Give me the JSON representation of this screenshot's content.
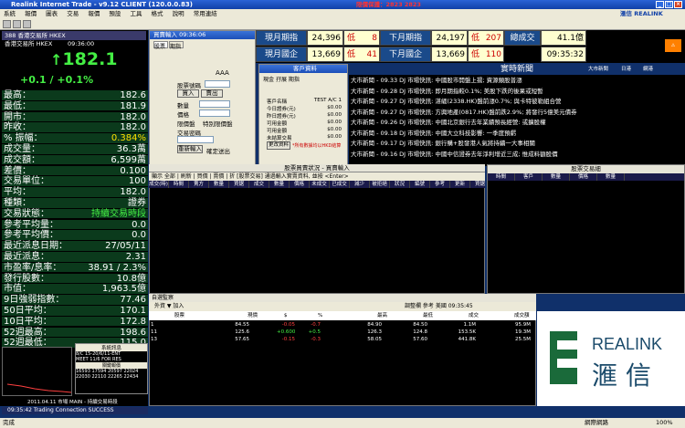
{
  "window": {
    "title": "Realink Internet Trade - v9.12 CLIENT (120.0.0.83)",
    "warning": "限價保護：2823 2823",
    "brand": "滙信 REALINK"
  },
  "menu": [
    "系統",
    "報價",
    "圖表",
    "交易",
    "報價",
    "預設",
    "工具",
    "格式",
    "說明",
    "常用連結"
  ],
  "left": {
    "header": "388 香港交易所 HKEX",
    "subheader": "香港交易所 HKEX",
    "time": "09:36:00",
    "price": "182.1",
    "arrow": "↑",
    "change": "+0.1 / +0.1%",
    "rows": [
      {
        "k": "最高：",
        "v": "182.6"
      },
      {
        "k": "最低：",
        "v": "181.9"
      },
      {
        "k": "開市：",
        "v": "182.0"
      },
      {
        "k": "昨收：",
        "v": "182.0"
      },
      {
        "k": "% 振幅：",
        "v": "0.384%"
      },
      {
        "k": "成交量：",
        "v": "36.3萬"
      },
      {
        "k": "成交額：",
        "v": "6,599萬"
      },
      {
        "k": "差價：",
        "v": "0.100"
      },
      {
        "k": "交易單位：",
        "v": "100"
      },
      {
        "k": "平均：",
        "v": "182.0"
      },
      {
        "k": "種類：",
        "v": "證券"
      },
      {
        "k": "交易狀態：",
        "v": "持續交易時段"
      },
      {
        "k": "參考平均量：",
        "v": "0.0"
      },
      {
        "k": "參考平均價：",
        "v": "0.0"
      },
      {
        "k": "最近派息日期：",
        "v": "27/05/11"
      },
      {
        "k": "最近派息：",
        "v": "2.31"
      },
      {
        "k": "市盈率/息率：",
        "v": "38.91 / 2.3%"
      },
      {
        "k": "發行股數：",
        "v": "10.8億"
      },
      {
        "k": "市值：",
        "v": "1,963.5億"
      },
      {
        "k": "9日強弱指數：",
        "v": "77.46"
      },
      {
        "k": "50日平均：",
        "v": "170.1"
      },
      {
        "k": "10日平均：",
        "v": "172.8"
      },
      {
        "k": "52週最高：",
        "v": "198.6"
      },
      {
        "k": "52週最低：",
        "v": "115.0"
      }
    ],
    "newsbox_title": "系統訊息",
    "newsbox_lines": [
      "8/C 15-20/6/11-ENT",
      "MEET 11/6 FOR RES",
      "關鍵報價",
      "16593 17594 20597 22024",
      "22030 22110 22265 22434"
    ],
    "date_line": "2011.04.11  市場 MAIN - 持續交易時段",
    "status": "09:35:42   Trading Connection SUCCESS"
  },
  "order": {
    "title": "買賣輸入 09:36:06",
    "tabs": [
      "股票",
      "期指"
    ],
    "labels": {
      "code": "股票號碼",
      "buy": "買入",
      "sell": "賣出",
      "qty": "數量",
      "price": "價格",
      "cond": "限價盤",
      "special": "特別限價盤",
      "pw": "交易密碼",
      "reset": "重新輸入",
      "confirm": "確定送出"
    },
    "lot_label": "AAA"
  },
  "account": {
    "title": "客戶資料",
    "tabs": [
      "現金",
      "孖展",
      "期指"
    ],
    "rows": [
      {
        "k": "客戶名稱",
        "v": "TEST A/C 1"
      },
      {
        "k": "今日證券(元)",
        "v": "$0.00"
      },
      {
        "k": "昨日證券(元)",
        "v": "$0.00"
      },
      {
        "k": "可用金額",
        "v": "$0.00"
      },
      {
        "k": "可用金額",
        "v": "$0.00"
      },
      {
        "k": "未結算交易",
        "v": "$0.00"
      }
    ],
    "update": "更改資料",
    "note": "*所有數據均以HKD結算"
  },
  "index": [
    {
      "label": "現月期指",
      "v1": "24,396",
      "tag": "低",
      "v2": "8"
    },
    {
      "label": "下月期指",
      "v1": "24,197",
      "tag": "低",
      "v2": "207"
    },
    {
      "label": "現月國企",
      "v1": "13,669",
      "tag": "低",
      "v2": "41"
    },
    {
      "label": "下月國企",
      "v1": "13,669",
      "tag": "低",
      "v2": "110"
    }
  ],
  "turnover": {
    "label": "總成交",
    "value": "41.1億",
    "time": "09:35:32"
  },
  "news": {
    "title": "實時新聞",
    "opts": [
      "大市新聞",
      "日港",
      "網港"
    ],
    "items": [
      "大市新聞 - 09.33  DJ 市場快訊:  中國股市開盤上揚; 資源類股普漲",
      "大市新聞 - 09.28  DJ 市場快訊:  即月期指較0.1%; 美股下跌的後果或短暫",
      "大市新聞 - 09.27  DJ 市場快訊:  湛緬(2338.HK)盤前漲0.7%; 與卡特彼勒組合營",
      "大市新聞 - 09.27  DJ 市場快訊:  方興地產(0817.HK)盤前跌2.9%; 將發行5億美元債券",
      "大市新聞 - 09.26  DJ 市場快訊:  中國北京銀行去年業績預長經營: 或擴股權",
      "大市新聞 - 09.18  DJ 市場快訊:  中國大立科技影響: 一季度預虧",
      "大市新聞 - 09.17  DJ 市場快訊:  銀行購+股發港人氣將持續一大事相關",
      "大市新聞 - 09.16  DJ 市場快訊:  中國中信證券去年淨利增近三成; 惟成料額股價"
    ]
  },
  "ordergrid": {
    "title": "股票買賣狀況 - 買賣輸入",
    "tools": "顯示 全部 | 刷新 | 買價 | 賣價 | 折 [股票交易] 通過輸入實賣資料, 並按 <Enter>",
    "cols": [
      "成交(時)",
      "時間",
      "賣方",
      "數量",
      "買鋸",
      "成交",
      "數量",
      "價格",
      "未成交",
      "已成交",
      "減少",
      "被拒絕",
      "狀況",
      "編號",
      "參考",
      "更新",
      "買鋸"
    ]
  },
  "trades": {
    "title": "股票交易細",
    "cols": [
      "時間",
      "客戶",
      "數量",
      "價格",
      "數量"
    ],
    "title2": "股票交易細"
  },
  "watchlist": {
    "title": "自選監察",
    "tools": "外資 ▼ 加入",
    "right": "調整欄 參考 美國 09:35:45",
    "cols": [
      "股票",
      "現價",
      "$",
      "%",
      "最高",
      "最低",
      "成交",
      "成交額"
    ],
    "rows": [
      {
        "code": "1",
        "now": "84.55",
        "chg": "-0.05",
        "pct": "-0.7",
        "hi": "84.90",
        "lo": "84.50",
        "vol": "1.1M",
        "amt": "95.9M"
      },
      {
        "code": "11",
        "now": "125.6",
        "chg": "+0.600",
        "pct": "+0.5",
        "hi": "126.3",
        "lo": "124.8",
        "vol": "153.5K",
        "amt": "19.3M"
      },
      {
        "code": "13",
        "now": "57.65",
        "chg": "-0.15",
        "pct": "-0.3",
        "hi": "58.05",
        "lo": "57.60",
        "vol": "441.8K",
        "amt": "25.5M"
      }
    ]
  },
  "bottom": {
    "left": "完成",
    "right": "網際網路",
    "zoom": "100%"
  }
}
